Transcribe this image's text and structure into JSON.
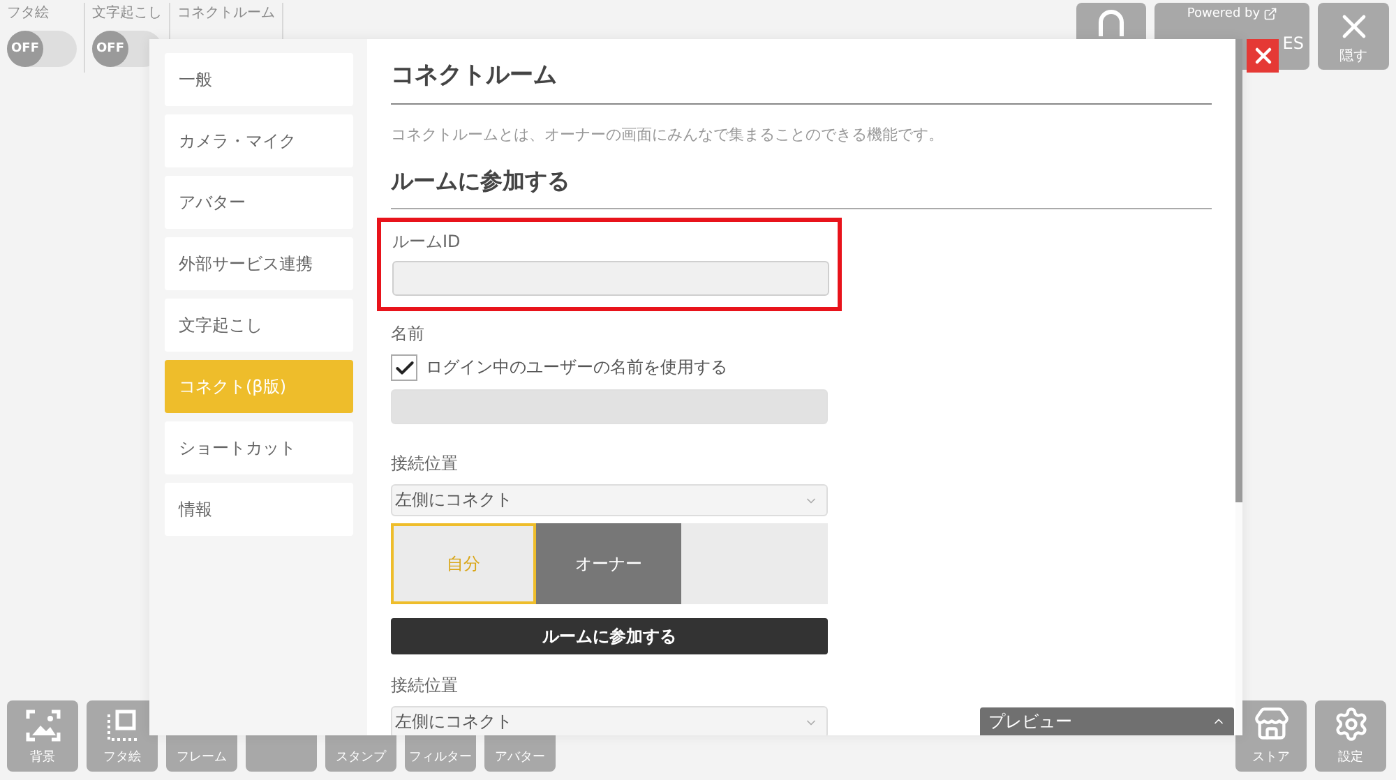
{
  "top_tabs": [
    {
      "label": "フタ絵",
      "toggle": {
        "text": "OFF",
        "on": false
      }
    },
    {
      "label": "文字起こし",
      "toggle": {
        "text": "OFF",
        "on": false
      }
    },
    {
      "label": "コネクトルーム"
    }
  ],
  "top_right": [
    {
      "kind": "home"
    },
    {
      "kind": "powered",
      "label": "Powered by",
      "extra": "ES"
    },
    {
      "kind": "hide",
      "label": "隠す"
    }
  ],
  "bottom_tools": [
    {
      "kind": "picture",
      "label": "背景"
    },
    {
      "kind": "lid",
      "label": "フタ絵"
    },
    {
      "kind": "covered",
      "label": "フレーム"
    },
    {
      "kind": "covered"
    },
    {
      "kind": "covered",
      "label": "スタンプ"
    },
    {
      "kind": "covered",
      "label": "フィルター"
    },
    {
      "kind": "covered",
      "label": "アバター"
    }
  ],
  "right_tools": [
    {
      "kind": "store",
      "label": "ストア"
    },
    {
      "kind": "settings",
      "label": "設定"
    }
  ],
  "dialog": {
    "sidebar": [
      {
        "label": "一般",
        "selected": false
      },
      {
        "label": "カメラ・マイク",
        "selected": false
      },
      {
        "label": "アバター",
        "selected": false
      },
      {
        "label": "外部サービス連携",
        "selected": false
      },
      {
        "label": "文字起こし",
        "selected": false
      },
      {
        "label": "コネクト(β版)",
        "selected": true
      },
      {
        "label": "ショートカット",
        "selected": false
      },
      {
        "label": "情報",
        "selected": false
      }
    ],
    "title": "コネクトルーム",
    "description": "コネクトルームとは、オーナーの画面にみんなで集まることのできる機能です。",
    "section": "ルームに参加する",
    "room_id": {
      "label": "ルームID",
      "highlighted": true
    },
    "name": {
      "label": "名前",
      "checkbox": {
        "label": "ログイン中のユーザーの名前を使用する",
        "checked": true
      },
      "disabled": true
    },
    "position": {
      "label": "接続位置",
      "value": "左側にコネクト"
    },
    "picker": [
      {
        "kind": "self",
        "label": "自分",
        "selected": true
      },
      {
        "kind": "owner",
        "label": "オーナー",
        "selected": false
      },
      {
        "kind": "empty"
      }
    ],
    "join_button": "ルームに参加する",
    "position2": {
      "label": "接続位置",
      "value": "左側にコネクト"
    },
    "preview": {
      "label": "プレビュー",
      "expanded": false
    }
  }
}
